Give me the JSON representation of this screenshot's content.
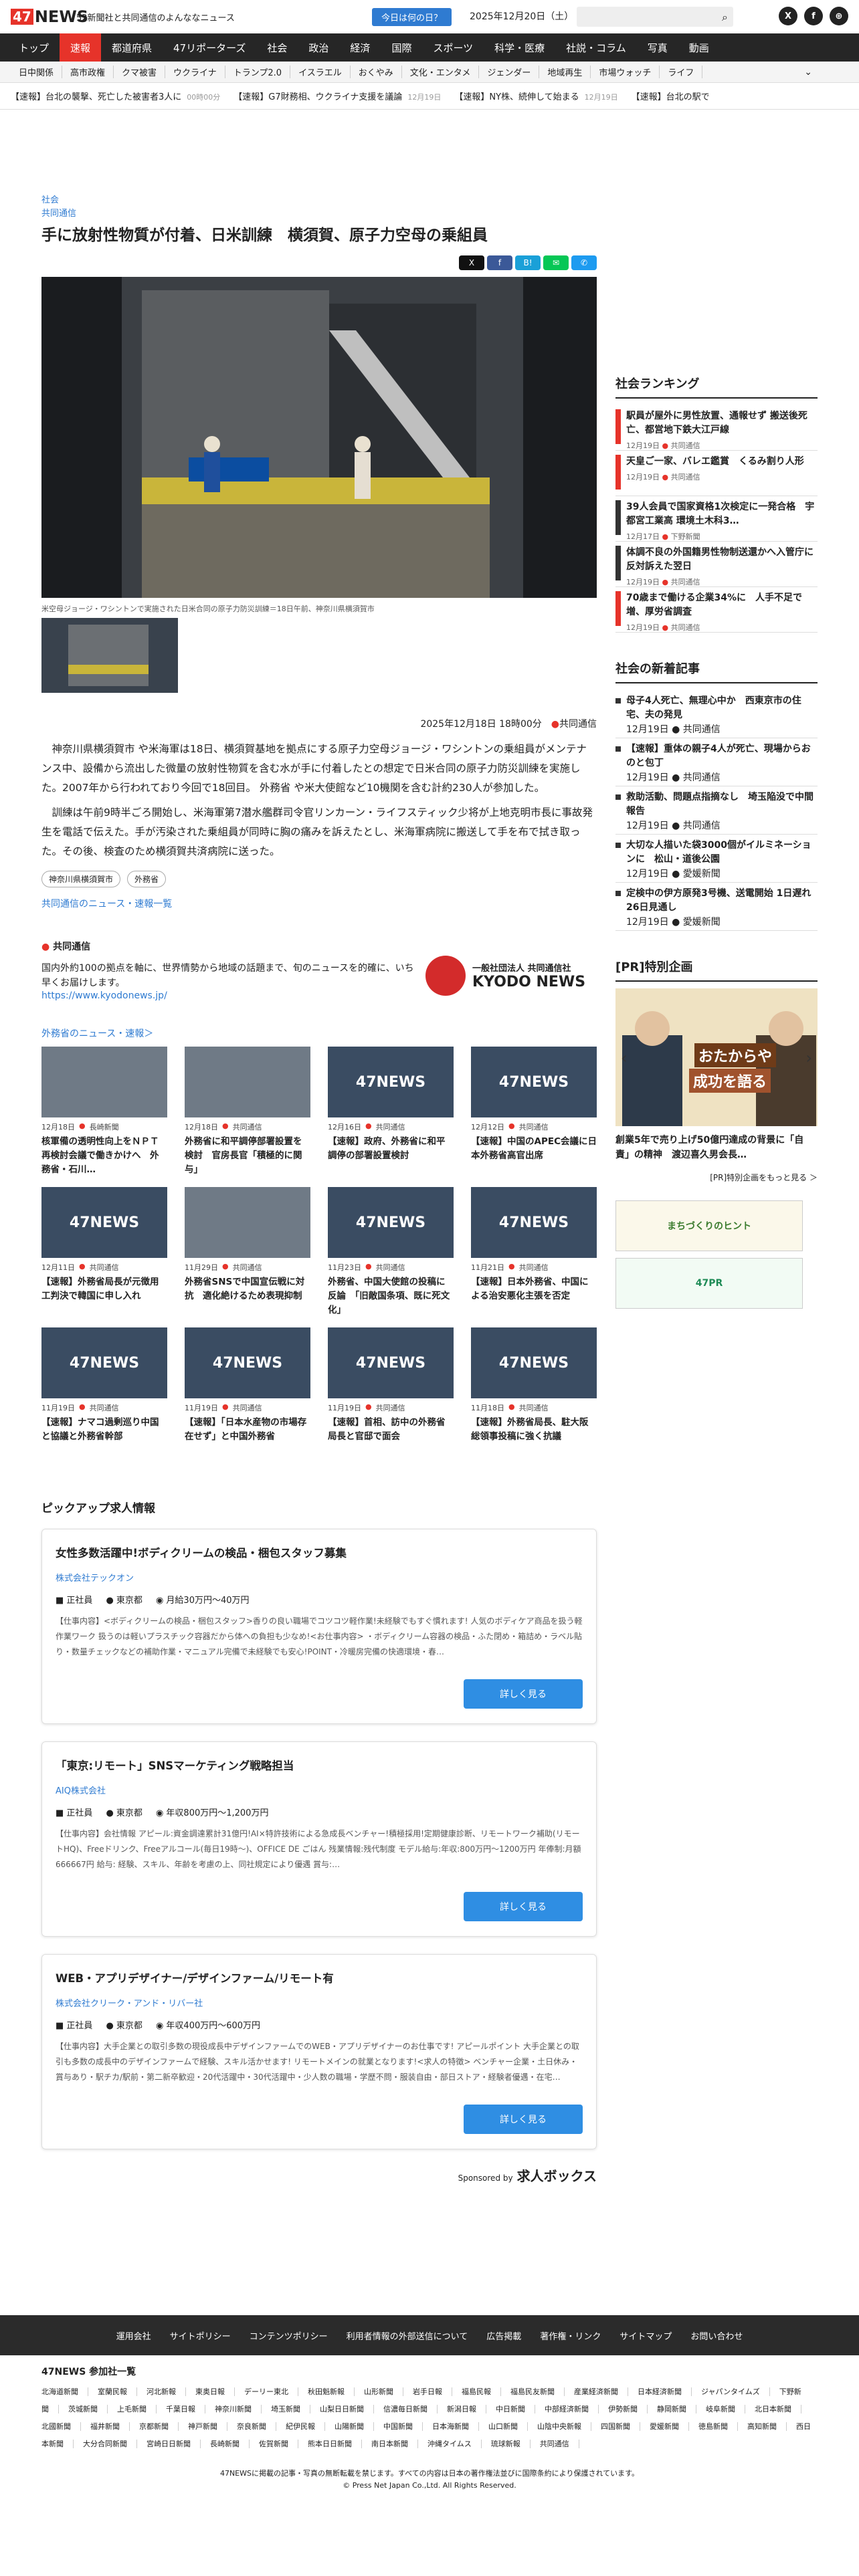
{
  "header": {
    "logo_num": "47",
    "logo_txt": "NEWS",
    "tagline": "52新聞社と共同通信のよんななニュース",
    "today": "今日は何の日？",
    "date": "2025年12月20日（土）",
    "social": [
      "X",
      "f",
      "⊕"
    ]
  },
  "nav_primary": [
    "トップ",
    "速報",
    "都道府県",
    "47リポーターズ",
    "社会",
    "政治",
    "経済",
    "国際",
    "スポーツ",
    "科学・医療",
    "社説・コラム",
    "写真",
    "動画"
  ],
  "nav_secondary": [
    "日中関係",
    "高市政権",
    "クマ被害",
    "ウクライナ",
    "トランプ2.0",
    "イスラエル",
    "おくやみ",
    "文化・エンタメ",
    "ジェンダー",
    "地域再生",
    "市場ウォッチ",
    "ライフ"
  ],
  "ticker": [
    {
      "text": "【速報】台北の襲撃、死亡した被害者3人に",
      "time": "00時00分"
    },
    {
      "text": "【速報】G7財務相、ウクライナ支援を議論",
      "time": "12月19日"
    },
    {
      "text": "【速報】NY株、続伸して始まる",
      "time": "12月19日"
    },
    {
      "text": "【速報】台北の駅で"
    }
  ],
  "article": {
    "category": "社会",
    "source": "共同通信",
    "title": "手に放射性物質が付着、日米訓練　横須賀、原子力空母の乗組員",
    "share": [
      "X",
      "f",
      "B!",
      "✉",
      "✆"
    ],
    "caption": "米空母ジョージ・ワシントンで実施された日米合同の原子力防災訓練＝18日午前、神奈川県横須賀市",
    "date": "2025年12月18日 18時00分",
    "byline": "共同通信",
    "paragraphs": [
      "神奈川県横須賀市 や米海軍は18日、横須賀基地を拠点にする原子力空母ジョージ・ワシントンの乗組員がメンテナンス中、設備から流出した微量の放射性物質を含む水が手に付着したとの想定で日米合同の原子力防災訓練を実施した。2007年から行われており今回で18回目。 外務省 や米大使館など10機関を含む計約230人が参加した。",
      "訓練は午前9時半ごろ開始し、米海軍第7潜水艦群司令官リンカーン・ライフスティック少将が上地克明市長に事故発生を電話で伝えた。手が汚染された乗組員が同時に胸の痛みを訴えたとし、米海軍病院に搬送して手を布で拭き取った。その後、検査のため横須賀共済病院に送った。"
    ],
    "tags": [
      "神奈川県横須賀市",
      "外務省"
    ],
    "more_link": "共同通信のニュース・速報一覧"
  },
  "kyodo": {
    "name": "共同通信",
    "desc": "国内外約100の拠点を軸に、世界情勢から地域の話題まで、旬のニュースを的確に、いち早くお届けします。",
    "url": "https://www.kyodonews.jp/",
    "logo_jp": "一般社団法人 共同通信社",
    "logo_en": "KYODO NEWS"
  },
  "related": {
    "label": "外務省のニュース・速報＞",
    "items": [
      {
        "date": "12月18日",
        "src": "長崎新聞",
        "title": "核軍備の透明性向上をＮＰＴ再検討会議で働きかけへ　外務省・石川…",
        "photo": true
      },
      {
        "date": "12月18日",
        "src": "共同通信",
        "title": "外務省に和平調停部署設置を検討　官房長官「積極的に関与」",
        "photo": true
      },
      {
        "date": "12月16日",
        "src": "共同通信",
        "title": "【速報】政府、外務省に和平調停の部署設置検討",
        "photo": false
      },
      {
        "date": "12月12日",
        "src": "共同通信",
        "title": "【速報】中国のAPEC会議に日本外務省高官出席",
        "photo": false
      },
      {
        "date": "12月11日",
        "src": "共同通信",
        "title": "【速報】外務省局長が元徴用工判決で韓国に申し入れ",
        "photo": false
      },
      {
        "date": "11月29日",
        "src": "共同通信",
        "title": "外務省SNSで中国宣伝戦に対抗　適化絶けるため表現抑制",
        "photo": true
      },
      {
        "date": "11月23日",
        "src": "共同通信",
        "title": "外務省、中国大使館の投稿に反論　「旧敵国条項、既に死文化」",
        "photo": false
      },
      {
        "date": "11月21日",
        "src": "共同通信",
        "title": "【速報】日本外務省、中国による治安悪化主張を否定",
        "photo": false
      },
      {
        "date": "11月19日",
        "src": "共同通信",
        "title": "【速報】ナマコ過剰巡り中国と協議と外務省幹部",
        "photo": false
      },
      {
        "date": "11月19日",
        "src": "共同通信",
        "title": "【速報】「日本水産物の市場存在せず」と中国外務省",
        "photo": false
      },
      {
        "date": "11月19日",
        "src": "共同通信",
        "title": "【速報】首相、訪中の外務省局長と官邸で面会",
        "photo": false
      },
      {
        "date": "11月18日",
        "src": "共同通信",
        "title": "【速報】外務省局長、駐大阪総領事投稿に強く抗議",
        "photo": false
      }
    ]
  },
  "jobs": {
    "heading": "ピックアップ求人情報",
    "button": "詳しく見る",
    "items": [
      {
        "title": "女性多数活躍中!ボディクリームの検品・梱包スタッフ募集",
        "company": "株式会社テックオン",
        "type": "正社員",
        "loc": "東京都",
        "pay": "月給30万円〜40万円",
        "desc": "【仕事内容】<ボディクリームの検品・梱包スタッフ>香りの良い職場でコツコツ軽作業!未経験でもすぐ慣れます! 人気のボディケア商品を扱う軽作業ワーク 扱うのは軽いプラスチック容器だから体への負担も少なめ!<お仕事内容> ・ボディクリーム容器の検品・ふた閉め・箱詰め・ラベル貼り・数量チェックなどの補助作業・マニュアル完備で未経験でも安心!POINT・冷暖房完備の快適環境・春…"
      },
      {
        "title": "「東京:リモート」SNSマーケティング戦略担当",
        "company": "AIQ株式会社",
        "type": "正社員",
        "loc": "東京都",
        "pay": "年収800万円〜1,200万円",
        "desc": "【仕事内容】会社情報 アピール:資金調達累計31億円!AI×特許技術による急成長ベンチャー!積極採用!定期健康診断、リモートワーク補助(リモートHQ)、Freeドリンク、Freeアルコール(毎日19時〜)、OFFICE DE ごはん 残業情報:残代制度 モデル給与:年収:800万円〜1200万円 年俸制:月額666667円 給与: 経験、スキル、年齢を考慮の上、同社規定により優遇 賞与:…"
      },
      {
        "title": "WEB・アプリデザイナー/デザインファーム/リモート有",
        "company": "株式会社クリーク・アンド・リバー社",
        "type": "正社員",
        "loc": "東京都",
        "pay": "年収400万円〜600万円",
        "desc": "【仕事内容】大手企業との取引多数の現役成長中デザインファームでのWEB・アプリデザイナーのお仕事です! アピールポイント 大手企業との取引も多数の成長中のデザインファームで経験、スキル活かせます! リモートメインの就業となります!<求人の特徴> ベンチャー企業・土日休み・賞与あり・駅チカ/駅前・第二新卒歓迎・20代活躍中・30代活躍中・少人数の職場・学歴不問・服装自由・部日ストア・経験者優遇・在宅…"
      }
    ],
    "sponsor": "Sponsored by",
    "sponsor_name": "求人ボックス"
  },
  "ranking": {
    "heading": "社会ランキング",
    "items": [
      {
        "title": "駅員が屋外に男性放置、通報せず 搬送後死亡、都営地下鉄大江戸線",
        "date": "12月19日",
        "src": "共同通信"
      },
      {
        "title": "天皇ご一家、バレエ鑑賞　くるみ割り人形",
        "date": "12月19日",
        "src": "共同通信"
      },
      {
        "title": "39人会員で国家資格1次検定に一発合格　宇都宮工業高 環境土木科3…",
        "date": "12月17日",
        "src": "下野新聞"
      },
      {
        "title": "体調不良の外国籍男性物制送還かへ入管庁に反対訴えた翌日",
        "date": "12月19日",
        "src": "共同通信"
      },
      {
        "title": "70歳まで働ける企業34%に　人手不足で増、厚労省調査",
        "date": "12月19日",
        "src": "共同通信"
      }
    ]
  },
  "social_news": {
    "heading": "社会の新着記事",
    "items": [
      {
        "title": "母子4人死亡、無理心中か　西東京市の住宅、夫の発見",
        "date": "12月19日",
        "src": "共同通信"
      },
      {
        "title": "【速報】重体の親子4人が死亡、現場からおのと包丁",
        "date": "12月19日",
        "src": "共同通信"
      },
      {
        "title": "救助活動、問題点指摘なし　埼玉陥没で中間報告",
        "date": "12月19日",
        "src": "共同通信"
      },
      {
        "title": "大切な人描いた袋3000個がイルミネーションに　松山・道後公園",
        "date": "12月19日",
        "src": "愛媛新聞"
      },
      {
        "title": "定検中の伊方原発3号機、送電開始 1日遅れ26日見通し",
        "date": "12月19日",
        "src": "愛媛新聞"
      }
    ]
  },
  "pr": {
    "heading": "[PR]特別企画",
    "banner_text": "おたからや",
    "banner_sub": "成功を語る",
    "title": "創業5年で売り上げ50億円達成の背景に「自責」の精神　渡辺喜久男会長…",
    "more": "[PR]特別企画をもっと見る ＞",
    "ad1": "まちづくりのヒント",
    "ad2": "47PR"
  },
  "footer": {
    "nav": [
      "運用会社",
      "サイトポリシー",
      "コンテンツポリシー",
      "利用者情報の外部送信について",
      "広告掲載",
      "著作権・リンク",
      "サイトマップ",
      "お問い合わせ"
    ],
    "join_title": "47NEWS 参加社一覧",
    "papers": [
      "北海道新聞",
      "室蘭民報",
      "河北新報",
      "東奥日報",
      "デーリー東北",
      "秋田魁新報",
      "山形新聞",
      "岩手日報",
      "福島民報",
      "福島民友新聞",
      "産業経済新聞",
      "日本経済新聞",
      "ジャパンタイムズ",
      "下野新聞",
      "茨城新聞",
      "上毛新聞",
      "千葉日報",
      "神奈川新聞",
      "埼玉新聞",
      "山梨日日新聞",
      "信濃毎日新聞",
      "新潟日報",
      "中日新聞",
      "中部経済新聞",
      "伊勢新聞",
      "静岡新聞",
      "岐阜新聞",
      "北日本新聞",
      "北國新聞",
      "福井新聞",
      "京都新聞",
      "神戸新聞",
      "奈良新聞",
      "紀伊民報",
      "山陽新聞",
      "中国新聞",
      "日本海新聞",
      "山口新聞",
      "山陰中央新報",
      "四国新聞",
      "愛媛新聞",
      "徳島新聞",
      "高知新聞",
      "西日本新聞",
      "大分合同新聞",
      "宮崎日日新聞",
      "長崎新聞",
      "佐賀新聞",
      "熊本日日新聞",
      "南日本新聞",
      "沖縄タイムス",
      "琉球新報",
      "共同通信"
    ],
    "copy1": "47NEWSに掲載の記事・写真の無断転載を禁じます。すべての内容は日本の著作権法並びに国際条約により保護されています。",
    "copy2": "© Press Net Japan Co.,Ltd. All Rights Reserved."
  }
}
